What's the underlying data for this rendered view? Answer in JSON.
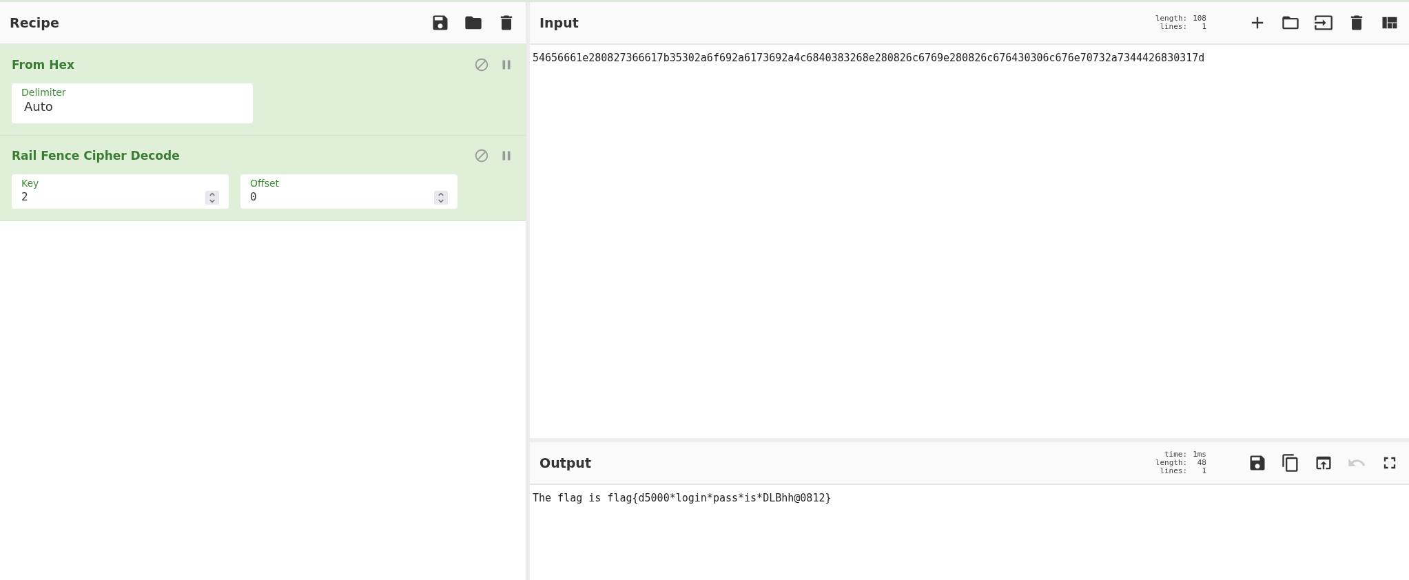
{
  "recipe": {
    "title": "Recipe",
    "operations": [
      {
        "name": "From Hex",
        "disabled": false,
        "breakpoint": false,
        "args": [
          {
            "kind": "select",
            "label": "Delimiter",
            "value": "Auto"
          }
        ]
      },
      {
        "name": "Rail Fence Cipher Decode",
        "disabled": false,
        "breakpoint": false,
        "args": [
          {
            "kind": "number",
            "label": "Key",
            "value": "2"
          },
          {
            "kind": "number",
            "label": "Offset",
            "value": "0"
          }
        ]
      }
    ]
  },
  "input": {
    "title": "Input",
    "stats": [
      {
        "label": "length:",
        "value": "108"
      },
      {
        "label": "lines:",
        "value": "1"
      }
    ],
    "buttons": [
      {
        "kind": "add",
        "disabled": false
      },
      {
        "kind": "open",
        "disabled": false
      },
      {
        "kind": "import",
        "disabled": false
      },
      {
        "kind": "clear",
        "disabled": false
      },
      {
        "kind": "layout",
        "disabled": false
      }
    ],
    "text": "54656661e280827366617b35302a6f692a6173692a4c6840383268e280826c6769e280826c676430306c676e70732a7344426830317d"
  },
  "output": {
    "title": "Output",
    "stats": [
      {
        "label": "time:",
        "value": "1ms"
      },
      {
        "label": "length:",
        "value": "48"
      },
      {
        "label": "lines:",
        "value": "1"
      }
    ],
    "buttons": [
      {
        "kind": "save",
        "disabled": false
      },
      {
        "kind": "copy",
        "disabled": false
      },
      {
        "kind": "replace",
        "disabled": false
      },
      {
        "kind": "undo",
        "disabled": true
      },
      {
        "kind": "maximise",
        "disabled": false
      }
    ],
    "text": "The flag is flag{d5000*login*pass*is*DLBhh@0812}"
  }
}
